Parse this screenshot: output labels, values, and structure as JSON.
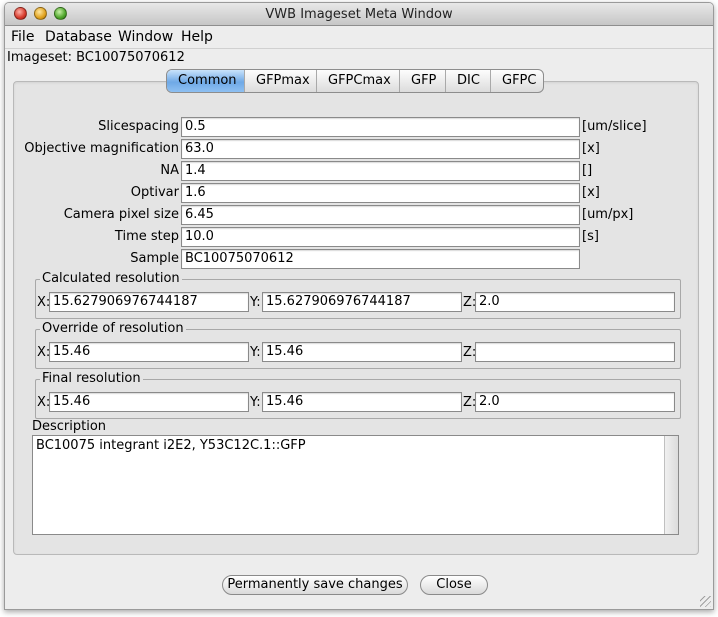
{
  "window": {
    "title": "VWB Imageset Meta Window"
  },
  "menu": [
    "File",
    "Database",
    "Window",
    "Help"
  ],
  "imageset_label": "Imageset: BC10075070612",
  "tabs": [
    "Common",
    "GFPmax",
    "GFPCmax",
    "GFP",
    "DIC",
    "GFPC"
  ],
  "active_tab": "Common",
  "fields": [
    {
      "label": "Slicespacing",
      "value": "0.5",
      "unit": "[um/slice]"
    },
    {
      "label": "Objective magnification",
      "value": "63.0",
      "unit": "[x]"
    },
    {
      "label": "NA",
      "value": "1.4",
      "unit": "[]"
    },
    {
      "label": "Optivar",
      "value": "1.6",
      "unit": "[x]"
    },
    {
      "label": "Camera pixel size",
      "value": "6.45",
      "unit": "[um/px]"
    },
    {
      "label": "Time step",
      "value": "10.0",
      "unit": "[s]"
    },
    {
      "label": "Sample",
      "value": "BC10075070612",
      "unit": ""
    }
  ],
  "groups": [
    {
      "title": "Calculated resolution",
      "x": "15.627906976744187",
      "y": "15.627906976744187",
      "z": "2.0"
    },
    {
      "title": "Override of resolution",
      "x": "15.46",
      "y": "15.46",
      "z": ""
    },
    {
      "title": "Final resolution",
      "x": "15.46",
      "y": "15.46",
      "z": "2.0"
    }
  ],
  "coord_labels": {
    "x": "X:",
    "y": "Y:",
    "z": "Z:"
  },
  "description": {
    "label": "Description",
    "value": "BC10075 integrant i2E2, Y53C12C.1::GFP"
  },
  "buttons": {
    "save": "Permanently save changes",
    "close": "Close"
  }
}
